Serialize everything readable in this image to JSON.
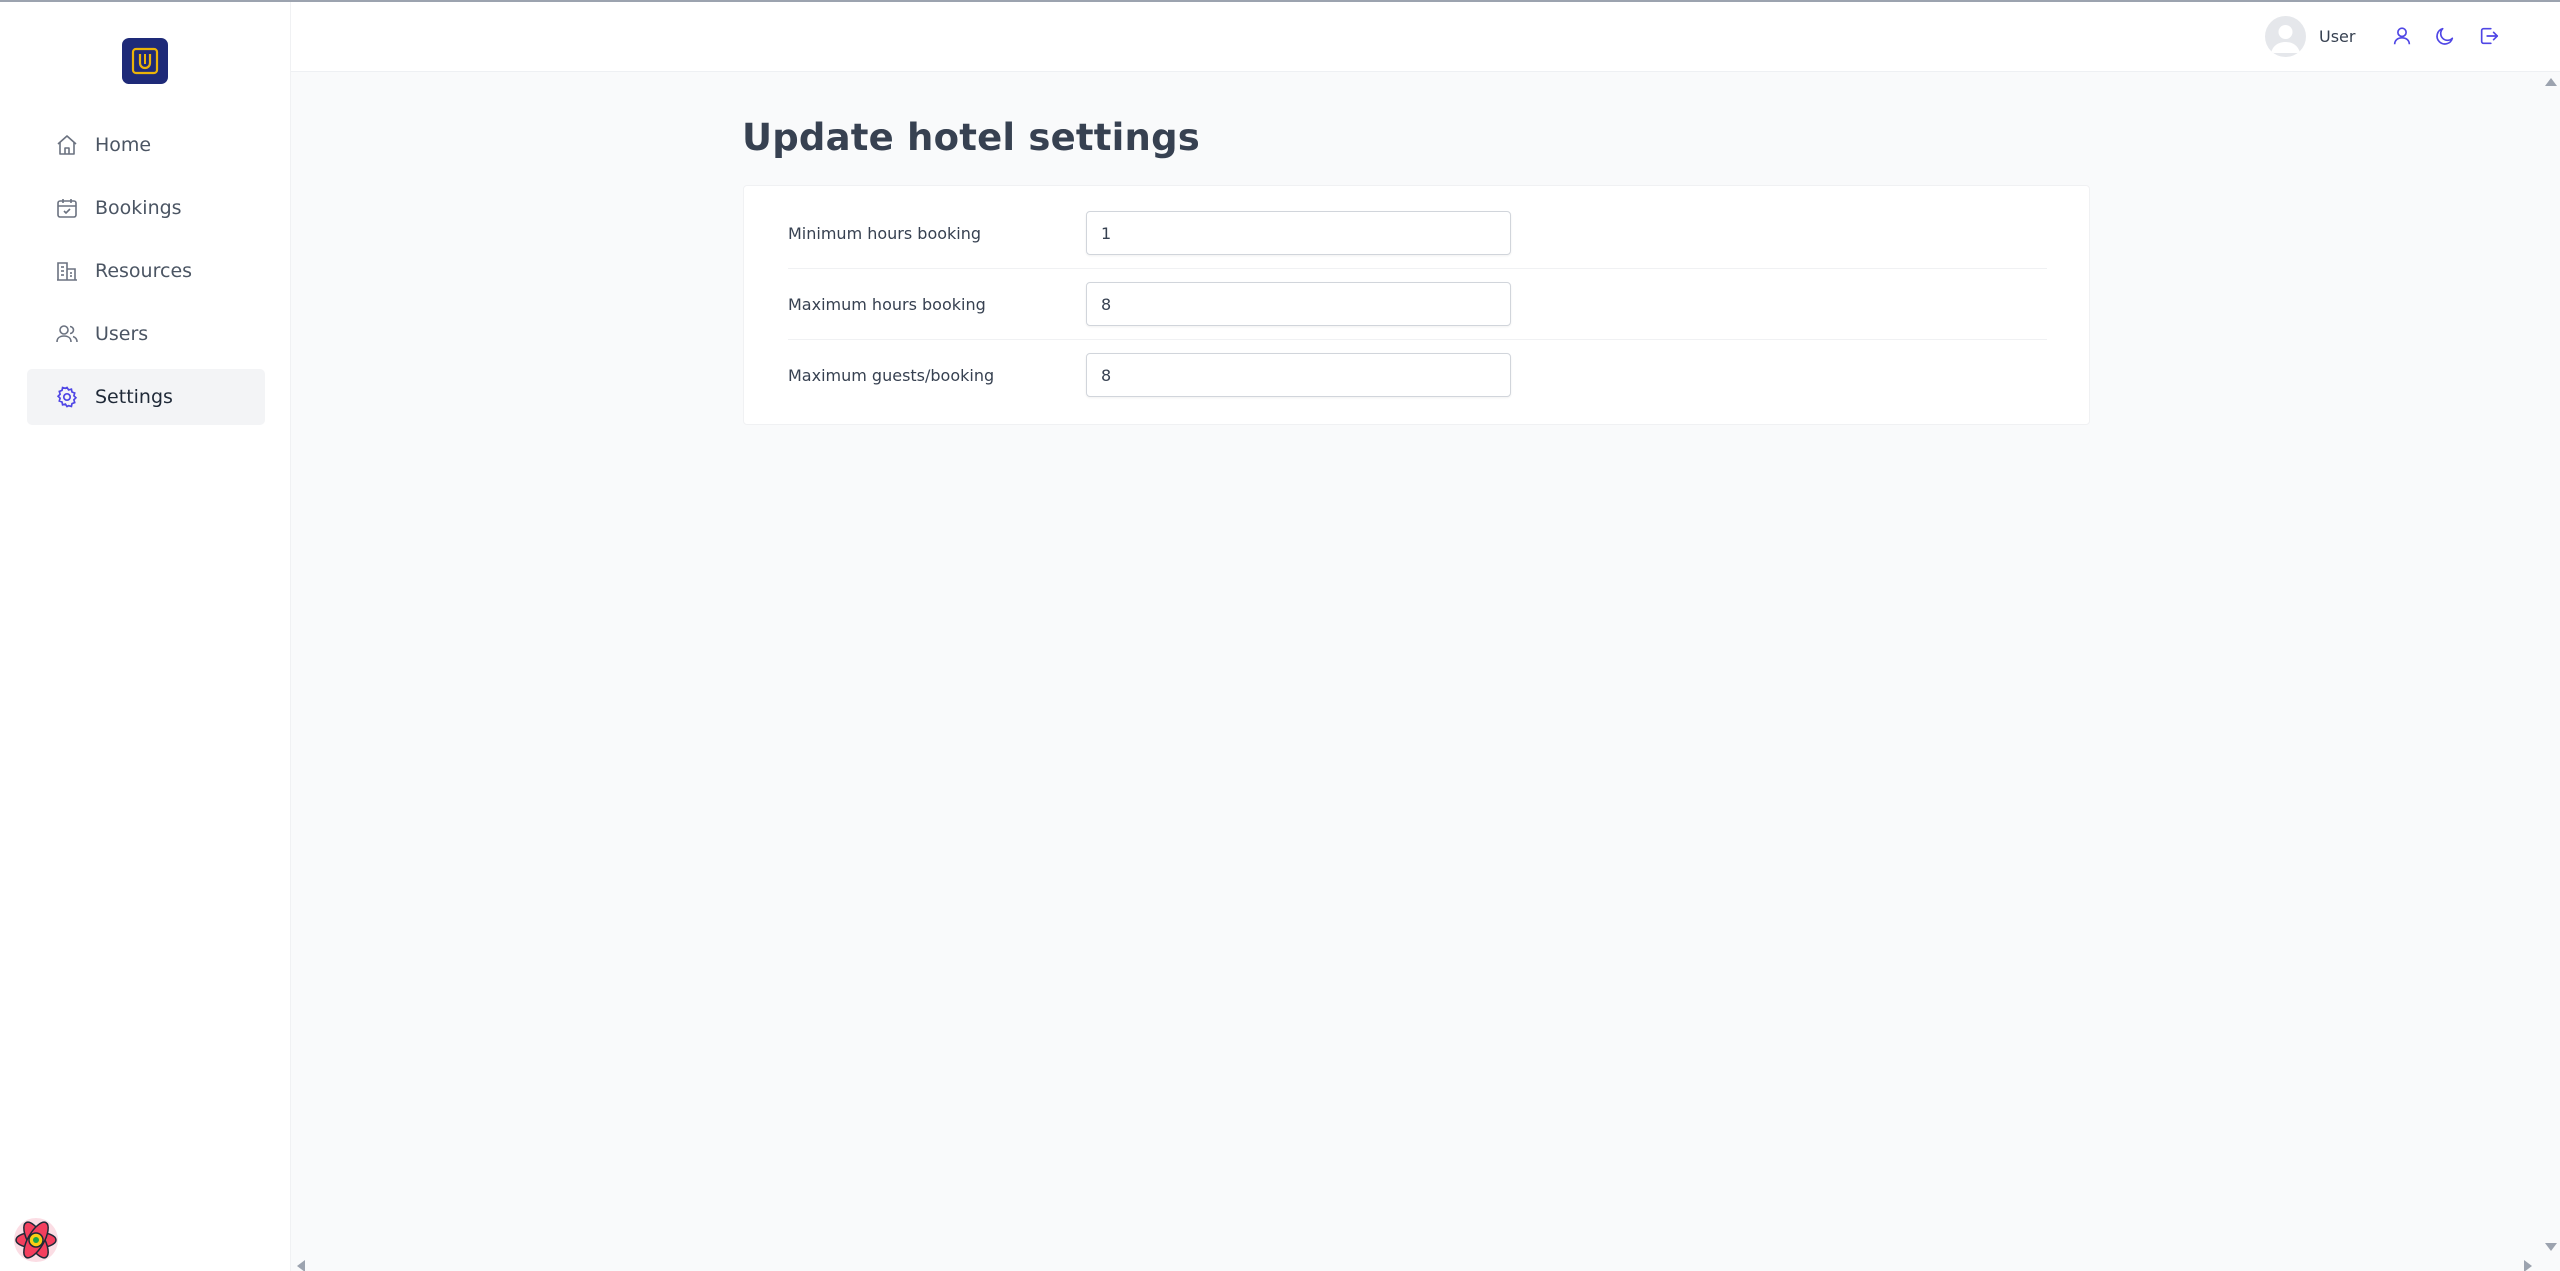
{
  "sidebar": {
    "items": [
      {
        "label": "Home",
        "icon": "home-icon"
      },
      {
        "label": "Bookings",
        "icon": "calendar-icon"
      },
      {
        "label": "Resources",
        "icon": "building-icon"
      },
      {
        "label": "Users",
        "icon": "users-icon"
      },
      {
        "label": "Settings",
        "icon": "gear-icon"
      }
    ],
    "active": "Settings"
  },
  "header": {
    "user_name": "User",
    "icons": [
      "user-icon",
      "moon-icon",
      "logout-icon"
    ]
  },
  "main": {
    "title": "Update hotel settings",
    "settings": [
      {
        "label": "Minimum hours booking",
        "value": "1"
      },
      {
        "label": "Maximum hours booking",
        "value": "8"
      },
      {
        "label": "Maximum guests/booking",
        "value": "8"
      }
    ]
  },
  "colors": {
    "brand": "#1e2a78",
    "accent": "#eab308",
    "icon": "#4f46e5"
  }
}
